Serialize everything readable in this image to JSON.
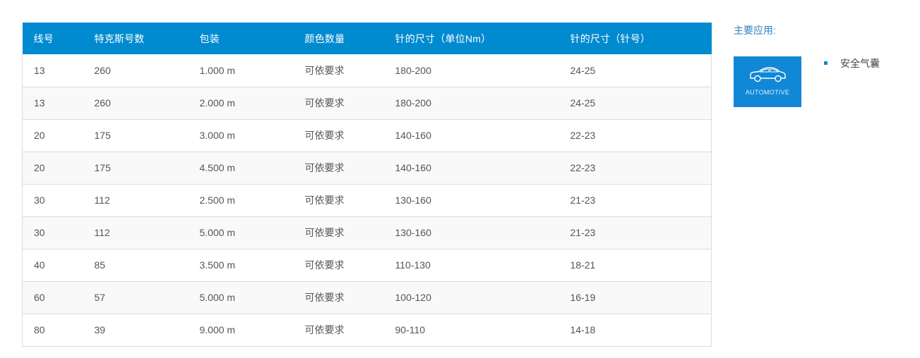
{
  "table": {
    "headers": [
      "线号",
      "特克斯号数",
      "包装",
      "颜色数量",
      "针的尺寸（单位Nm）",
      "针的尺寸（针号）"
    ],
    "rows": [
      [
        "13",
        "260",
        "1.000 m",
        "可依要求",
        "180-200",
        "24-25"
      ],
      [
        "13",
        "260",
        "2.000 m",
        "可依要求",
        "180-200",
        "24-25"
      ],
      [
        "20",
        "175",
        "3.000 m",
        "可依要求",
        "140-160",
        "22-23"
      ],
      [
        "20",
        "175",
        "4.500 m",
        "可依要求",
        "140-160",
        "22-23"
      ],
      [
        "30",
        "112",
        "2.500 m",
        "可依要求",
        "130-160",
        "21-23"
      ],
      [
        "30",
        "112",
        "5.000 m",
        "可依要求",
        "130-160",
        "21-23"
      ],
      [
        "40",
        "85",
        "3.500 m",
        "可依要求",
        "110-130",
        "18-21"
      ],
      [
        "60",
        "57",
        "5.000 m",
        "可依要求",
        "100-120",
        "16-19"
      ],
      [
        "80",
        "39",
        "9.000 m",
        "可依要求",
        "90-110",
        "14-18"
      ]
    ]
  },
  "applications": {
    "title": "主要应用:",
    "tile": {
      "icon": "car-icon",
      "label": "AUTOMOTIVE",
      "color": "#1188d6"
    },
    "items": [
      "安全气囊"
    ]
  },
  "colors": {
    "header_bg": "#008acf",
    "accent": "#1188d6"
  }
}
